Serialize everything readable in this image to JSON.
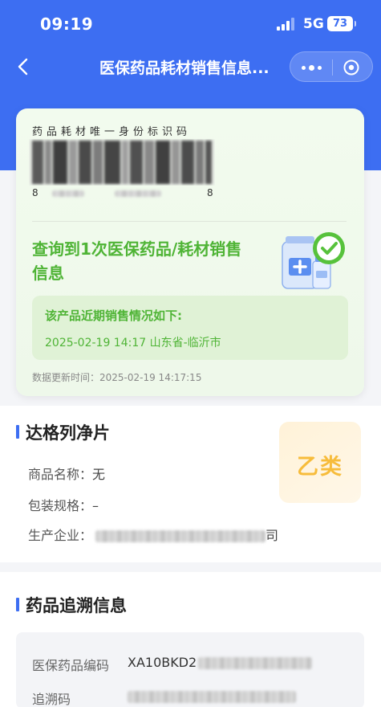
{
  "status_bar": {
    "time": "09:19",
    "network": "5G",
    "battery": "73"
  },
  "nav": {
    "title": "医保药品耗材销售信息..."
  },
  "card": {
    "code_label": "药品耗材唯一身份标识码",
    "barcode_digit_start": "8",
    "barcode_digit_end": "8",
    "query_result": "查询到1次医保药品/耗材销售信息",
    "sales_heading": "该产品近期销售情况如下:",
    "sales_record": "2025-02-19 14:17 山东省-临沂市",
    "updated": "数据更新时间：2025-02-19 14:17:15"
  },
  "product": {
    "name": "达格列净片",
    "category_badge": "乙类",
    "fields": [
      {
        "label": "商品名称：",
        "value": "无"
      },
      {
        "label": "包装规格：",
        "value": "–"
      },
      {
        "label": "生产企业：",
        "value_tail": "司"
      }
    ]
  },
  "trace": {
    "title": "药品追溯信息",
    "rows": [
      {
        "label": "医保药品编码",
        "value_prefix": "XA10BKD2"
      },
      {
        "label": "追溯码",
        "value_prefix": ""
      }
    ]
  }
}
